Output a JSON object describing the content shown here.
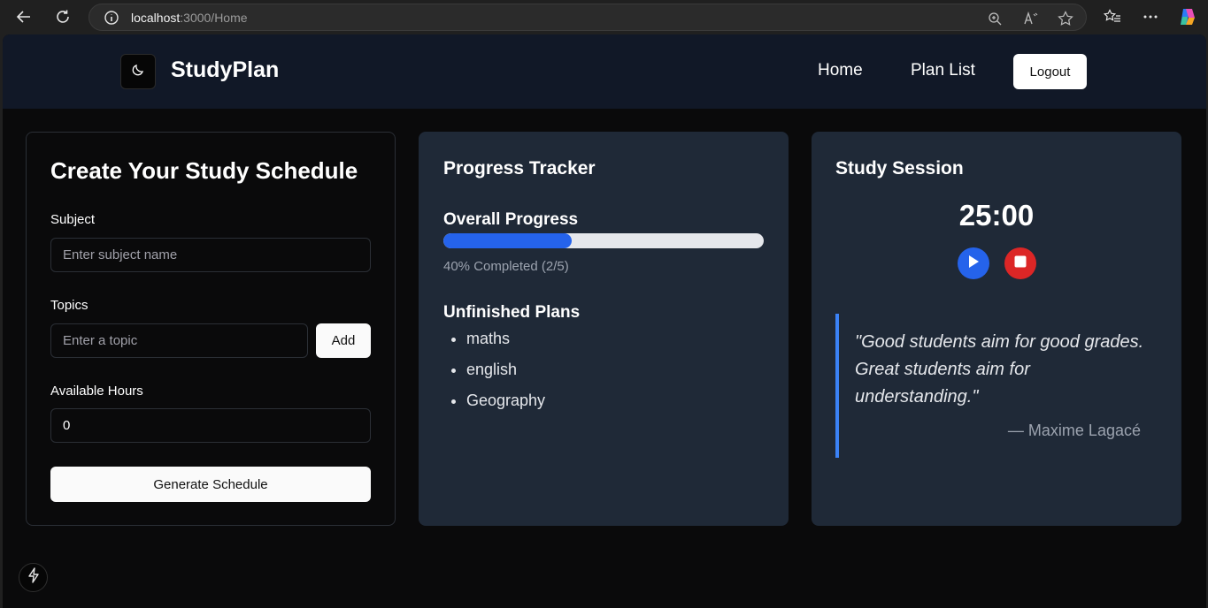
{
  "browser": {
    "url_host": "localhost",
    "url_path": ":3000/Home"
  },
  "header": {
    "brand": "StudyPlan",
    "nav": {
      "home": "Home",
      "plan_list": "Plan List"
    },
    "logout_label": "Logout"
  },
  "schedule_form": {
    "title": "Create Your Study Schedule",
    "subject_label": "Subject",
    "subject_placeholder": "Enter subject name",
    "subject_value": "",
    "topics_label": "Topics",
    "topic_placeholder": "Enter a topic",
    "topic_value": "",
    "add_label": "Add",
    "hours_label": "Available Hours",
    "hours_value": "0",
    "generate_label": "Generate Schedule"
  },
  "progress": {
    "title": "Progress Tracker",
    "overall_label": "Overall Progress",
    "percent": 40,
    "completed_text": "40% Completed (2/5)",
    "unfinished_label": "Unfinished Plans",
    "unfinished_plans": [
      "maths",
      "english",
      "Geography"
    ]
  },
  "session": {
    "title": "Study Session",
    "timer": "25:00",
    "quote": "\"Good students aim for good grades. Great students aim for understanding.\"",
    "author": "— Maxime Lagacé"
  },
  "colors": {
    "accent": "#2563eb",
    "stop": "#dc2626",
    "card": "#1f2937",
    "header": "#111827"
  },
  "icons": [
    "back-arrow-icon",
    "refresh-icon",
    "info-icon",
    "zoom-icon",
    "read-aloud-icon",
    "favorite-star-icon",
    "favorites-list-icon",
    "more-icon",
    "copilot-icon",
    "moon-icon",
    "play-icon",
    "stop-icon",
    "bolt-icon"
  ]
}
